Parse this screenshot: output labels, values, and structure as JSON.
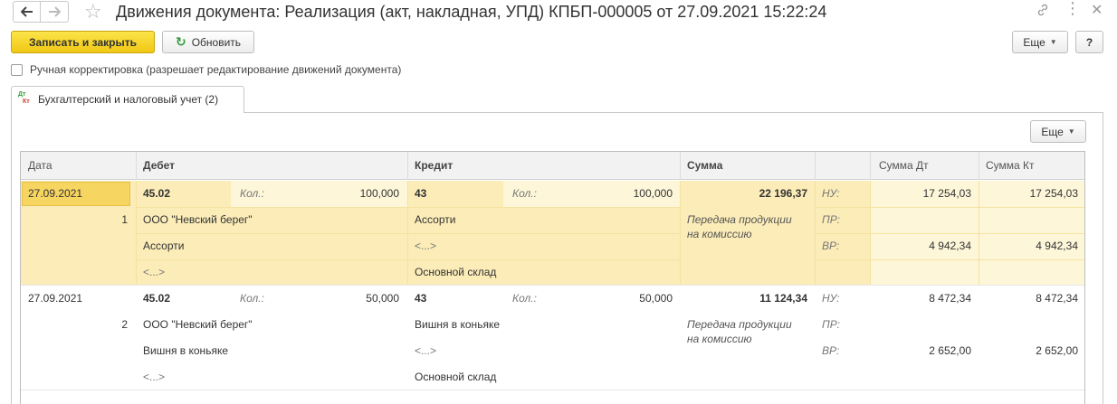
{
  "window": {
    "title": "Движения документа: Реализация (акт, накладная, УПД) КПБП-000005 от 27.09.2021 15:22:24"
  },
  "toolbar": {
    "save_close_label": "Записать и закрыть",
    "refresh_label": "Обновить",
    "more_label": "Еще",
    "help_label": "?"
  },
  "manual_edit": {
    "label": "Ручная корректировка (разрешает редактирование движений документа)",
    "checked": false
  },
  "tabs": [
    {
      "label": "Бухгалтерский и налоговый учет (2)",
      "icon_top": "Дт",
      "icon_bottom": "Кт"
    }
  ],
  "panel": {
    "more_label": "Еще"
  },
  "table": {
    "headers": {
      "date": "Дата",
      "debit": "Дебет",
      "credit": "Кредит",
      "sum": "Сумма",
      "sum_dt": "Сумма Дт",
      "sum_kt": "Сумма Кт"
    },
    "rows": [
      {
        "date": "27.09.2021",
        "num": "1",
        "debit_account": "45.02",
        "qty_label": "Кол.:",
        "debit_qty": "100,000",
        "debit_sub1": "ООО \"Невский берег\"",
        "debit_sub2": "Ассорти",
        "debit_sub3": "<...>",
        "credit_account": "43",
        "credit_qty": "100,000",
        "credit_sub1": "Ассорти",
        "credit_sub2": "<...>",
        "credit_sub3": "Основной склад",
        "sum": "22 196,37",
        "content_1": "Передача продукции",
        "content_2": "на комиссию",
        "nu_label": "НУ:",
        "pr_label": "ПР:",
        "vr_label": "ВР:",
        "nu_dt": "17 254,03",
        "nu_kt": "17 254,03",
        "vr_dt": "4 942,34",
        "vr_kt": "4 942,34"
      },
      {
        "date": "27.09.2021",
        "num": "2",
        "debit_account": "45.02",
        "qty_label": "Кол.:",
        "debit_qty": "50,000",
        "debit_sub1": "ООО \"Невский берег\"",
        "debit_sub2": "Вишня в коньяке",
        "debit_sub3": "<...>",
        "credit_account": "43",
        "credit_qty": "50,000",
        "credit_sub1": "Вишня в коньяке",
        "credit_sub2": "<...>",
        "credit_sub3": "Основной склад",
        "sum": "11 124,34",
        "content_1": "Передача продукции",
        "content_2": "на комиссию",
        "nu_label": "НУ:",
        "pr_label": "ПР:",
        "vr_label": "ВР:",
        "nu_dt": "8 472,34",
        "nu_kt": "8 472,34",
        "vr_dt": "2 652,00",
        "vr_kt": "2 652,00"
      }
    ]
  },
  "colors": {
    "primary_button": "#f4d025",
    "selected_row": "#fbecb8",
    "refresh_icon": "#2f9b3b"
  }
}
